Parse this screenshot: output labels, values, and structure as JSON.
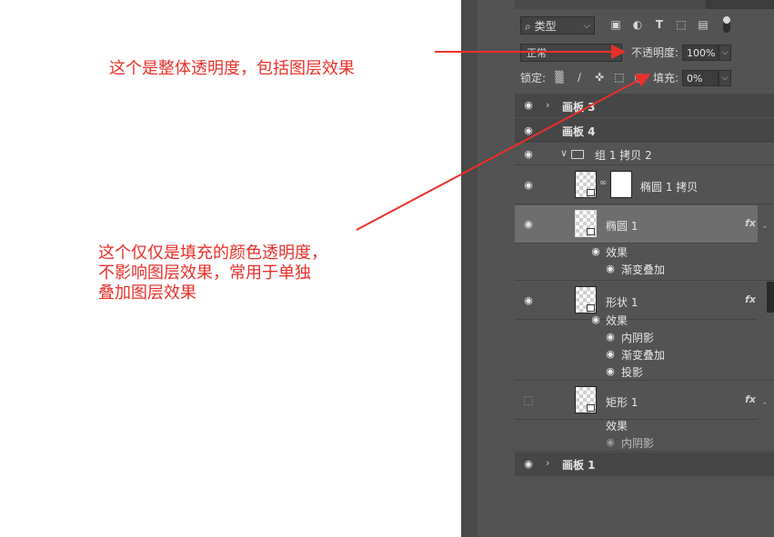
{
  "annotations": {
    "top": "这个是整体透明度，包括图层效果",
    "middle": [
      "这个仅仅是填充的颜色透明度，",
      "不影响图层效果，常用于单独",
      "叠加图层效果"
    ]
  },
  "toolbar": {
    "filter_label": "类型",
    "icons": [
      "search-icon",
      "image-filter-icon",
      "adjustment-filter-icon",
      "type-filter-icon",
      "shape-filter-icon",
      "smart-object-filter-icon",
      "filter-toggle-icon"
    ]
  },
  "blend": {
    "mode": "正常",
    "opacity_label": "不透明度:",
    "opacity_value": "100%",
    "lock_label": "锁定:",
    "fill_label": "填充:",
    "fill_value": "0%"
  },
  "layers": {
    "artboard3": "画板 3",
    "artboard4": "画板 4",
    "group": "组 1 拷贝 2",
    "ellipse_copy": "椭圆 1 拷贝",
    "ellipse": "椭圆 1",
    "ellipse_effects": "效果",
    "ellipse_effect1": "渐变叠加",
    "shape": "形状 1",
    "shape_effects": "效果",
    "shape_effect1": "内阴影",
    "shape_effect2": "渐变叠加",
    "shape_effect3": "投影",
    "rect": "矩形 1",
    "rect_effects": "效果",
    "rect_effect1": "内阴影",
    "artboard1": "画板 1",
    "fx_label": "fx"
  },
  "colors": {
    "annotation": "#e8302a",
    "panel_bg": "#535353",
    "selected_row": "#6e6e6e"
  }
}
